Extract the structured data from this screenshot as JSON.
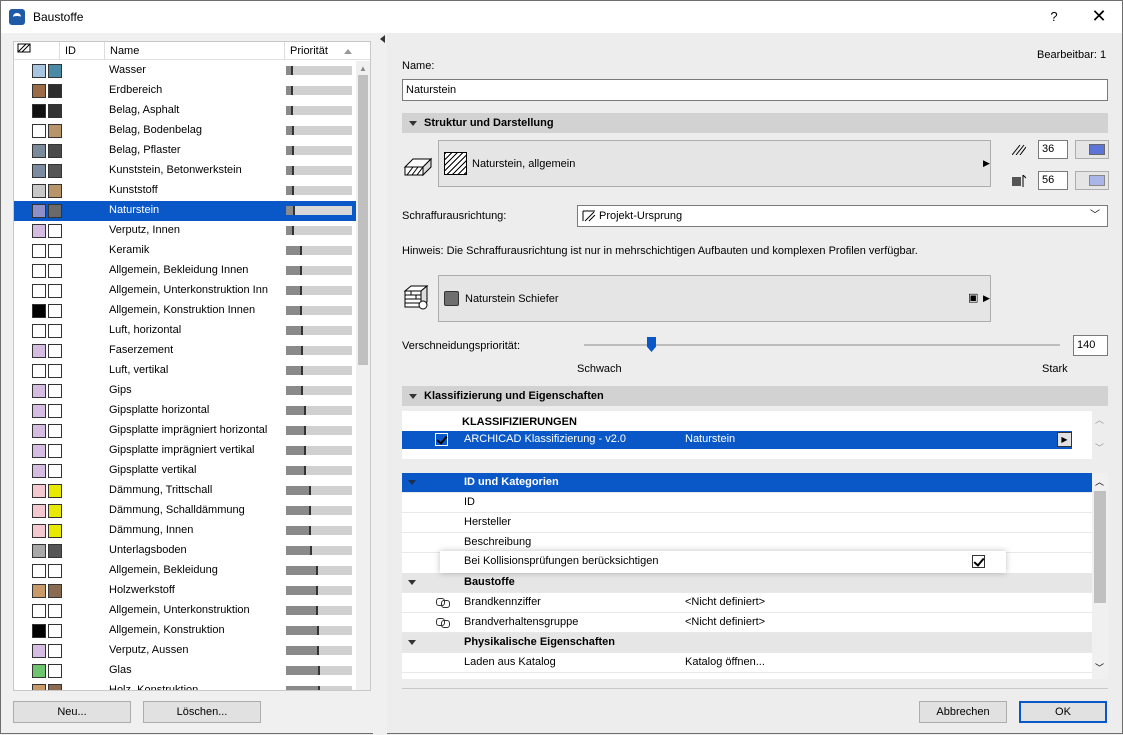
{
  "window": {
    "title": "Baustoffe",
    "help": "?",
    "close": "✕"
  },
  "list": {
    "headers": {
      "id": "ID",
      "name": "Name",
      "priority": "Priorität"
    },
    "items": [
      {
        "name": "Wasser",
        "c1": "#a7c4e0",
        "c2": "#4b8aa6",
        "prio": 0.1
      },
      {
        "name": "Erdbereich",
        "c1": "#9b6b48",
        "c2": "#2d2d2d",
        "prio": 0.1
      },
      {
        "name": "Belag, Asphalt",
        "c1": "#111111",
        "c2": "#333333",
        "prio": 0.1
      },
      {
        "name": "Belag, Bodenbelag",
        "c1": "#ffffff",
        "c2": "#b8946a",
        "prio": 0.12
      },
      {
        "name": "Belag, Pflaster",
        "c1": "#7a8a9a",
        "c2": "#4a4a4a",
        "prio": 0.12
      },
      {
        "name": "Kunststein, Betonwerkstein",
        "c1": "#7c8ca0",
        "c2": "#555555",
        "prio": 0.12
      },
      {
        "name": "Kunststoff",
        "c1": "#c8c8c8",
        "c2": "#b8946a",
        "prio": 0.12
      },
      {
        "name": "Naturstein",
        "c1": "#9090c8",
        "c2": "#6a6a6a",
        "prio": 0.14,
        "selected": true
      },
      {
        "name": "Verputz, Innen",
        "c1": "#d4bde0",
        "c2": "#ffffff",
        "prio": 0.12
      },
      {
        "name": "Keramik",
        "c1": "#ffffff",
        "c2": "#ffffff",
        "prio": 0.24
      },
      {
        "name": "Allgemein, Bekleidung Innen",
        "c1": "#ffffff",
        "c2": "#ffffff",
        "prio": 0.24
      },
      {
        "name": "Allgemein, Unterkonstruktion Inn",
        "c1": "#ffffff",
        "c2": "#ffffff",
        "prio": 0.24
      },
      {
        "name": "Allgemein, Konstruktion Innen",
        "c1": "#000000",
        "c2": "#ffffff",
        "prio": 0.24
      },
      {
        "name": "Luft, horizontal",
        "c1": "#ffffff",
        "c2": "#ffffff",
        "prio": 0.26
      },
      {
        "name": "Faserzement",
        "c1": "#d4bde0",
        "c2": "#ffffff",
        "prio": 0.26
      },
      {
        "name": "Luft, vertikal",
        "c1": "#ffffff",
        "c2": "#ffffff",
        "prio": 0.26
      },
      {
        "name": "Gips",
        "c1": "#d4bde0",
        "c2": "#ffffff",
        "prio": 0.26
      },
      {
        "name": "Gipsplatte horizontal",
        "c1": "#d4bde0",
        "c2": "#ffffff",
        "prio": 0.3
      },
      {
        "name": "Gipsplatte imprägniert horizontal",
        "c1": "#d4bde0",
        "c2": "#ffffff",
        "prio": 0.3
      },
      {
        "name": "Gipsplatte imprägniert vertikal",
        "c1": "#d4bde0",
        "c2": "#ffffff",
        "prio": 0.3
      },
      {
        "name": "Gipsplatte vertikal",
        "c1": "#d4bde0",
        "c2": "#ffffff",
        "prio": 0.3
      },
      {
        "name": "Dämmung, Trittschall",
        "c1": "#f4c8d0",
        "c2": "#e8e800",
        "prio": 0.38
      },
      {
        "name": "Dämmung, Schalldämmung",
        "c1": "#f4c8d0",
        "c2": "#e8e800",
        "prio": 0.38
      },
      {
        "name": "Dämmung, Innen",
        "c1": "#f4c8d0",
        "c2": "#e8e800",
        "prio": 0.38
      },
      {
        "name": "Unterlagsboden",
        "c1": "#a8a8a8",
        "c2": "#555555",
        "prio": 0.4
      },
      {
        "name": "Allgemein, Bekleidung",
        "c1": "#ffffff",
        "c2": "#ffffff",
        "prio": 0.48
      },
      {
        "name": "Holzwerkstoff",
        "c1": "#c89a6a",
        "c2": "#8a6a50",
        "prio": 0.48
      },
      {
        "name": "Allgemein, Unterkonstruktion",
        "c1": "#ffffff",
        "c2": "#ffffff",
        "prio": 0.48
      },
      {
        "name": "Allgemein, Konstruktion",
        "c1": "#000000",
        "c2": "#ffffff",
        "prio": 0.5
      },
      {
        "name": "Verputz, Aussen",
        "c1": "#d4bde0",
        "c2": "#ffffff",
        "prio": 0.5
      },
      {
        "name": "Glas",
        "c1": "#6cc46c",
        "c2": "#ffffff",
        "prio": 0.52
      },
      {
        "name": "Holz, Konstruktion",
        "c1": "#c89a6a",
        "c2": "#8a6a50",
        "prio": 0.52
      }
    ],
    "new_label": "Neu...",
    "delete_label": "Löschen..."
  },
  "editable": "Bearbeitbar: 1",
  "name_label": "Name:",
  "name_value": "Naturstein",
  "structure": {
    "section_title": "Struktur und Darstellung",
    "fill_name": "Naturstein, allgemein",
    "pen1": "36",
    "pen2": "56",
    "pen1_color": "#5b74d6",
    "pen2_color": "#aab6e8",
    "orientation_label": "Schraffurausrichtung:",
    "orientation_value": "Projekt-Ursprung",
    "hint": "Hinweis: Die Schraffurausrichtung ist nur in mehrschichtigen Aufbauten und komplexen Profilen verfügbar.",
    "surface_name": "Naturstein Schiefer",
    "priority_label": "Verschneidungspriorität:",
    "priority_value": "140",
    "priority_level": 0.14,
    "weak": "Schwach",
    "strong": "Stark"
  },
  "classification": {
    "section_title": "Klassifizierung und Eigenschaften",
    "header": "KLASSIFIZIERUNGEN",
    "row_system": "ARCHICAD Klassifizierung - v2.0",
    "row_value": "Naturstein"
  },
  "properties": {
    "group1": "ID und Kategorien",
    "id": "ID",
    "manufacturer": "Hersteller",
    "description": "Beschreibung",
    "collision": "Bei Kollisionsprüfungen berücksichtigen",
    "group2": "Baustoffe",
    "fire_code": "Brandkennziffer",
    "fire_code_val": "<Nicht definiert>",
    "fire_group": "Brandverhaltensgruppe",
    "fire_group_val": "<Nicht definiert>",
    "group3": "Physikalische Eigenschaften",
    "catalog": "Laden aus Katalog",
    "catalog_val": "Katalog öffnen..."
  },
  "buttons": {
    "cancel": "Abbrechen",
    "ok": "OK"
  }
}
